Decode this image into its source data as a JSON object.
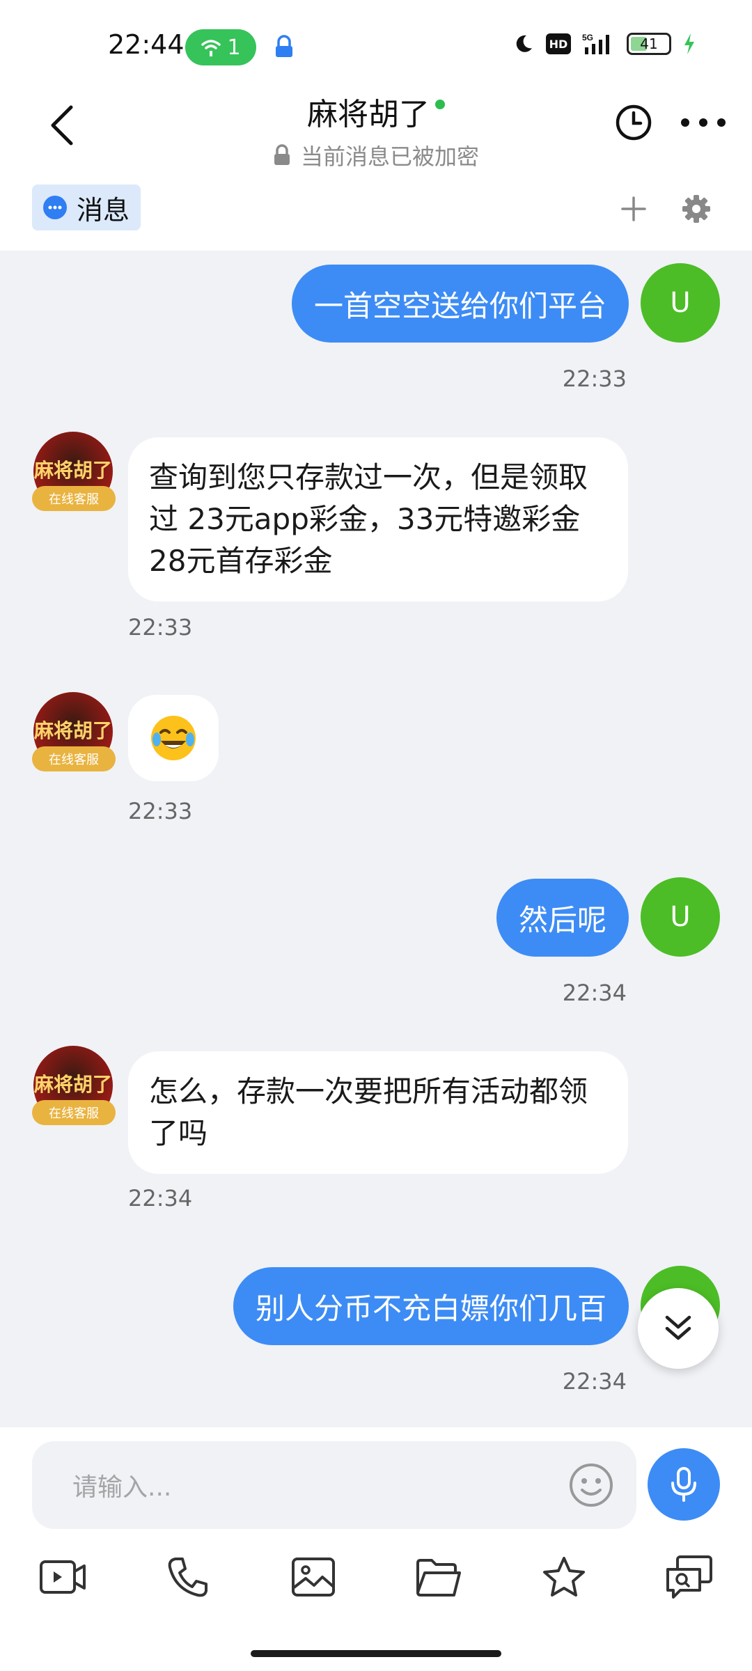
{
  "status_bar": {
    "time": "22:44",
    "wifi_count": "1",
    "network": "5G",
    "hd_label": "HD",
    "battery": "41"
  },
  "header": {
    "title": "麻将胡了",
    "subtitle": "当前消息已被加密"
  },
  "tabs": {
    "message_label": "消息"
  },
  "messages": [
    {
      "side": "right",
      "text": "一首空空送给你们平台",
      "time": "22:33",
      "avatar": "U"
    },
    {
      "side": "left",
      "text": "查询到您只存款过一次，但是领取过 23元app彩金，33元特邀彩金  28元首存彩金",
      "time": "22:33",
      "tag": "在线客服",
      "logo": "麻将胡了"
    },
    {
      "side": "left",
      "emoji": "😂",
      "time": "22:33",
      "tag": "在线客服",
      "logo": "麻将胡了"
    },
    {
      "side": "right",
      "text": "然后呢",
      "time": "22:34",
      "avatar": "U"
    },
    {
      "side": "left",
      "text": "怎么，存款一次要把所有活动都领了吗",
      "time": "22:34",
      "tag": "在线客服",
      "logo": "麻将胡了"
    },
    {
      "side": "right",
      "text": "别人分币不充白嫖你们几百",
      "time": "22:34",
      "avatar": "U"
    }
  ],
  "input": {
    "placeholder": "请输入..."
  },
  "toolbar_icons": [
    "video-icon",
    "phone-icon",
    "image-icon",
    "folder-icon",
    "star-icon",
    "screen-share-icon"
  ],
  "colors": {
    "accent": "#3d8cf5",
    "user_avatar": "#4cbd26",
    "chat_bg": "#f0f2f6",
    "online": "#2dbd4e",
    "agent_tag": "#e9b340"
  }
}
